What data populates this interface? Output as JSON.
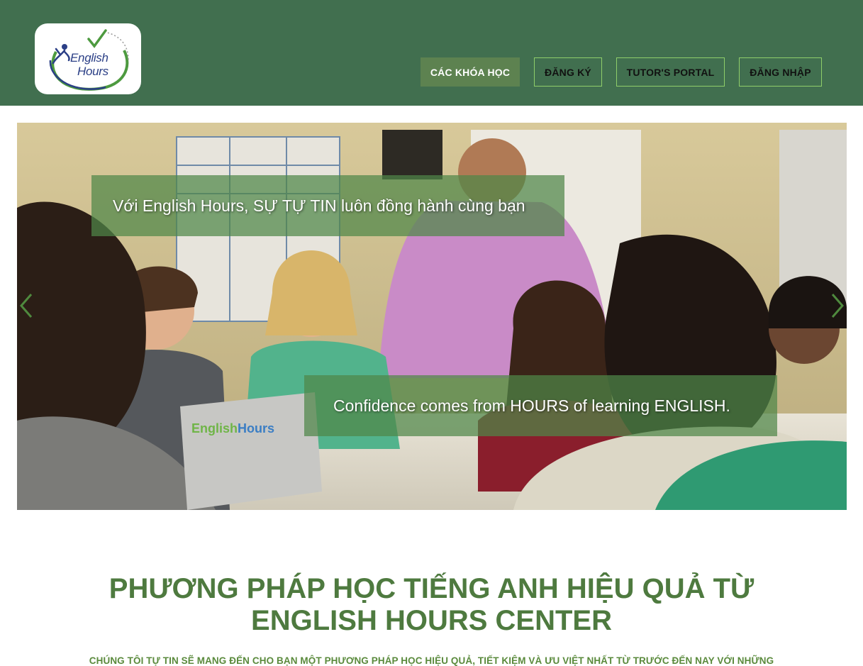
{
  "header": {
    "logo": {
      "line1": "English",
      "line2": "Hours"
    },
    "nav": [
      {
        "label": "CÁC KHÓA HỌC"
      },
      {
        "label": "ĐĂNG KÝ"
      },
      {
        "label": "TUTOR'S PORTAL"
      },
      {
        "label": "ĐĂNG NHẬP"
      }
    ]
  },
  "carousel": {
    "caption_top": "Với English Hours, SỰ TỰ TIN luôn đồng hành cùng bạn",
    "caption_bottom": "Confidence comes from HOURS of learning ENGLISH.",
    "laptop_brand_a": "English",
    "laptop_brand_b": "Hours",
    "prev_icon": "chevron-left-icon",
    "next_icon": "chevron-right-icon"
  },
  "section": {
    "headline_line1": "PHƯƠNG PHÁP HỌC TIẾNG ANH HIỆU QUẢ TỪ",
    "headline_line2": "ENGLISH HOURS CENTER",
    "subline": "CHÚNG TÔI TỰ TIN SẼ MANG ĐẾN CHO BẠN MỘT PHƯƠNG PHÁP HỌC HIỆU QUẢ, TIẾT KIỆM VÀ ƯU VIỆT NHẤT TỪ TRƯỚC ĐẾN NAY VỚI NHỮNG"
  },
  "colors": {
    "header_bg": "#416f4f",
    "active_nav_bg": "#5d8250",
    "nav_border": "#8fce6a",
    "headline": "#4e7a3f",
    "caption_bg": "#4f8748"
  }
}
